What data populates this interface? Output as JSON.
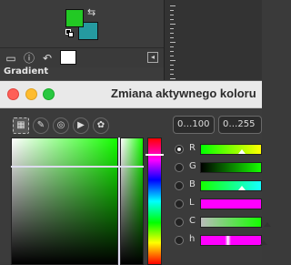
{
  "colors": {
    "foreground": "#22c924",
    "background": "#259aa0",
    "current_hue": "#14ff00"
  },
  "toolbox": {
    "icons": [
      "display-icon",
      "info-icon",
      "undo-icon"
    ],
    "section_title": "Gradient"
  },
  "dialog": {
    "title": "Zmiana aktywnego koloru",
    "selectors": [
      "scales-selector",
      "water-selector",
      "wheel-selector",
      "triangle-selector",
      "watercolor-selector"
    ],
    "range_buttons": [
      "0…100",
      "0…255"
    ],
    "channels": [
      {
        "label": "R",
        "selected": true
      },
      {
        "label": "G",
        "selected": false
      },
      {
        "label": "B",
        "selected": false
      },
      {
        "label": "L",
        "selected": false
      },
      {
        "label": "C",
        "selected": false
      },
      {
        "label": "h",
        "selected": false
      }
    ]
  }
}
